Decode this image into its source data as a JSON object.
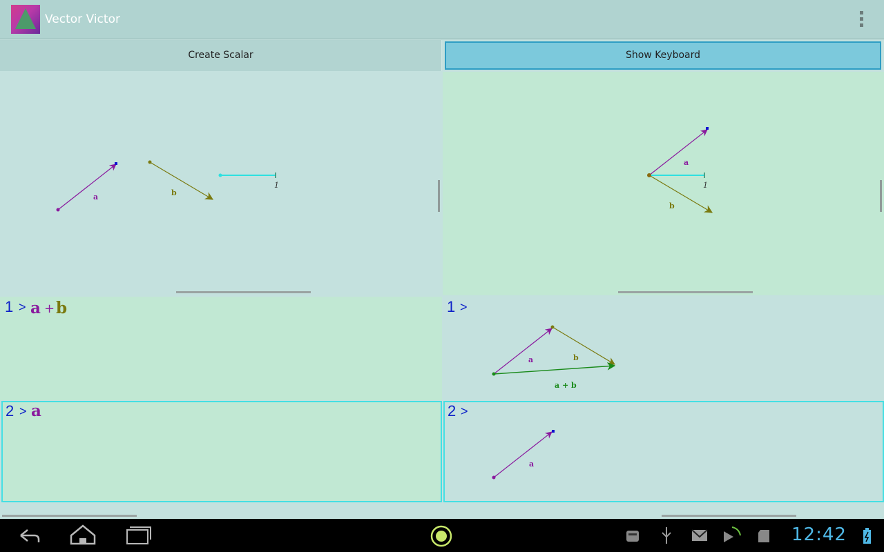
{
  "app": {
    "title": "Vector Victor"
  },
  "buttons": {
    "create_scalar": "Create Scalar",
    "show_keyboard": "Show Keyboard"
  },
  "canvas_left": {
    "vector_a_label": "a",
    "vector_b_label": "b",
    "scalar_label": "1"
  },
  "canvas_right": {
    "vector_a_label": "a",
    "vector_b_label": "b",
    "scalar_label": "1"
  },
  "history": {
    "entries": [
      {
        "number": "1",
        "prompt": ">",
        "input": {
          "a": "a",
          "plus": "+",
          "b": "b"
        },
        "result_labels": {
          "a": "a",
          "b": "b",
          "sum": "a + b"
        }
      },
      {
        "number": "2",
        "prompt": ">",
        "input": {
          "a": "a"
        },
        "result_labels": {
          "a": "a"
        }
      }
    ]
  },
  "status_bar": {
    "time": "12:42"
  },
  "colors": {
    "vector_a": "#8a1a9e",
    "vector_b": "#7a7a10",
    "vector_sum": "#1a8a1a",
    "scalar": "#2ee0e0",
    "index_blue": "#0c1fc8",
    "selected_border": "#45dfe3",
    "clock": "#4fb8e6"
  },
  "icons": [
    "app-icon",
    "overflow-menu-icon",
    "back-icon",
    "home-icon",
    "recent-apps-icon",
    "center-launcher-icon",
    "android-debug-icon",
    "usb-icon",
    "gmail-icon",
    "play-store-icon",
    "sd-card-icon",
    "battery-charging-icon"
  ]
}
